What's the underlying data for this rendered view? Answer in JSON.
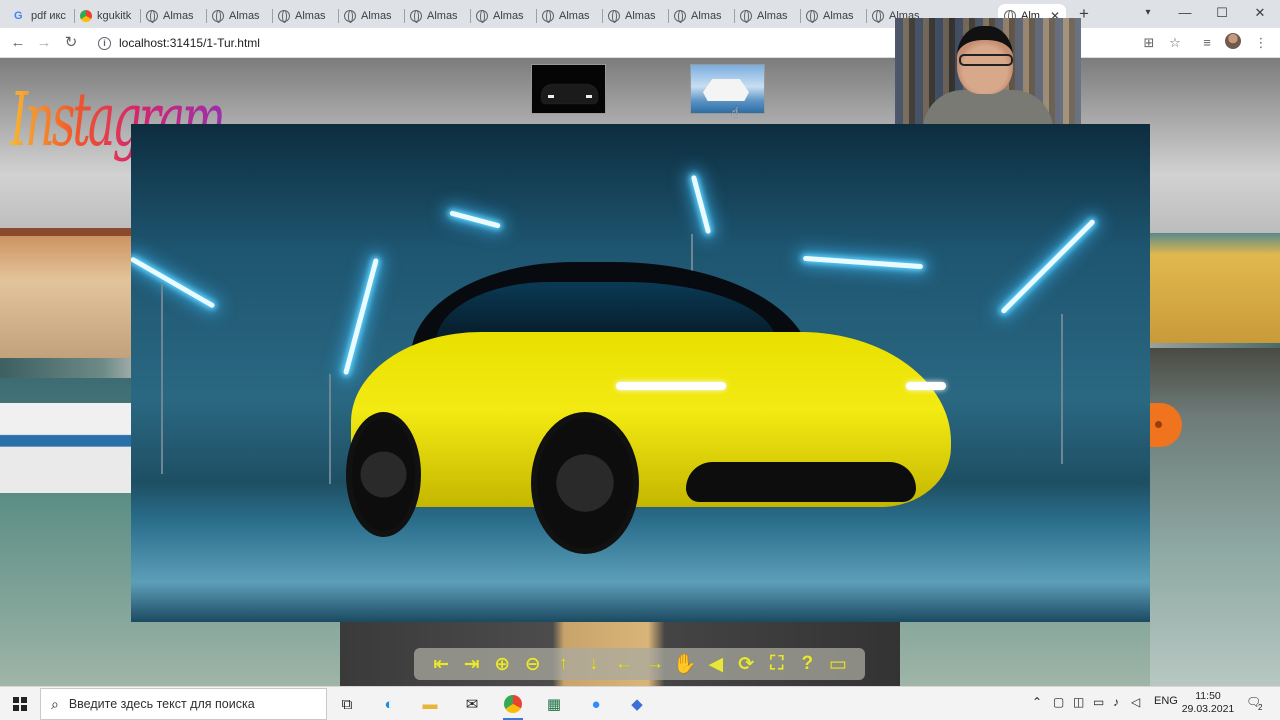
{
  "browser": {
    "tabs": [
      {
        "label": "pdf икс",
        "icon": "google-icon"
      },
      {
        "label": "kgukitk",
        "icon": "chrome-icon"
      },
      {
        "label": "Almas",
        "icon": "globe-icon"
      },
      {
        "label": "Almas",
        "icon": "globe-icon"
      },
      {
        "label": "Almas",
        "icon": "globe-icon"
      },
      {
        "label": "Almas",
        "icon": "globe-icon"
      },
      {
        "label": "Almas",
        "icon": "globe-icon"
      },
      {
        "label": "Almas",
        "icon": "globe-icon"
      },
      {
        "label": "Almas",
        "icon": "globe-icon"
      },
      {
        "label": "Almas",
        "icon": "globe-icon"
      },
      {
        "label": "Almas",
        "icon": "globe-icon"
      },
      {
        "label": "Almas",
        "icon": "globe-icon"
      },
      {
        "label": "Almas",
        "icon": "globe-icon"
      },
      {
        "label": "Almas",
        "icon": "globe-icon"
      },
      {
        "label": "Alm",
        "icon": "globe-icon",
        "active": true
      }
    ],
    "new_tab": "+",
    "window_controls": {
      "minimize": "—",
      "maximize": "☐",
      "close": "✕",
      "profile_menu": "▾"
    },
    "url": "localhost:31415/1-Tur.html"
  },
  "page": {
    "logo_text": "Instagram",
    "thumbnails": [
      "car-thumbnail",
      "ship-thumbnail"
    ],
    "nav_buttons": [
      "first-page",
      "last-page",
      "zoom-in",
      "zoom-out",
      "up",
      "down",
      "left",
      "right",
      "pan",
      "sound",
      "rotate",
      "fullscreen",
      "help",
      "window"
    ],
    "accent_color": "#e8e63a"
  },
  "taskbar": {
    "search_placeholder": "Введите здесь текст для поиска",
    "language": "ENG",
    "time": "11:50",
    "date": "29.03.2021",
    "notification_count": "2"
  }
}
